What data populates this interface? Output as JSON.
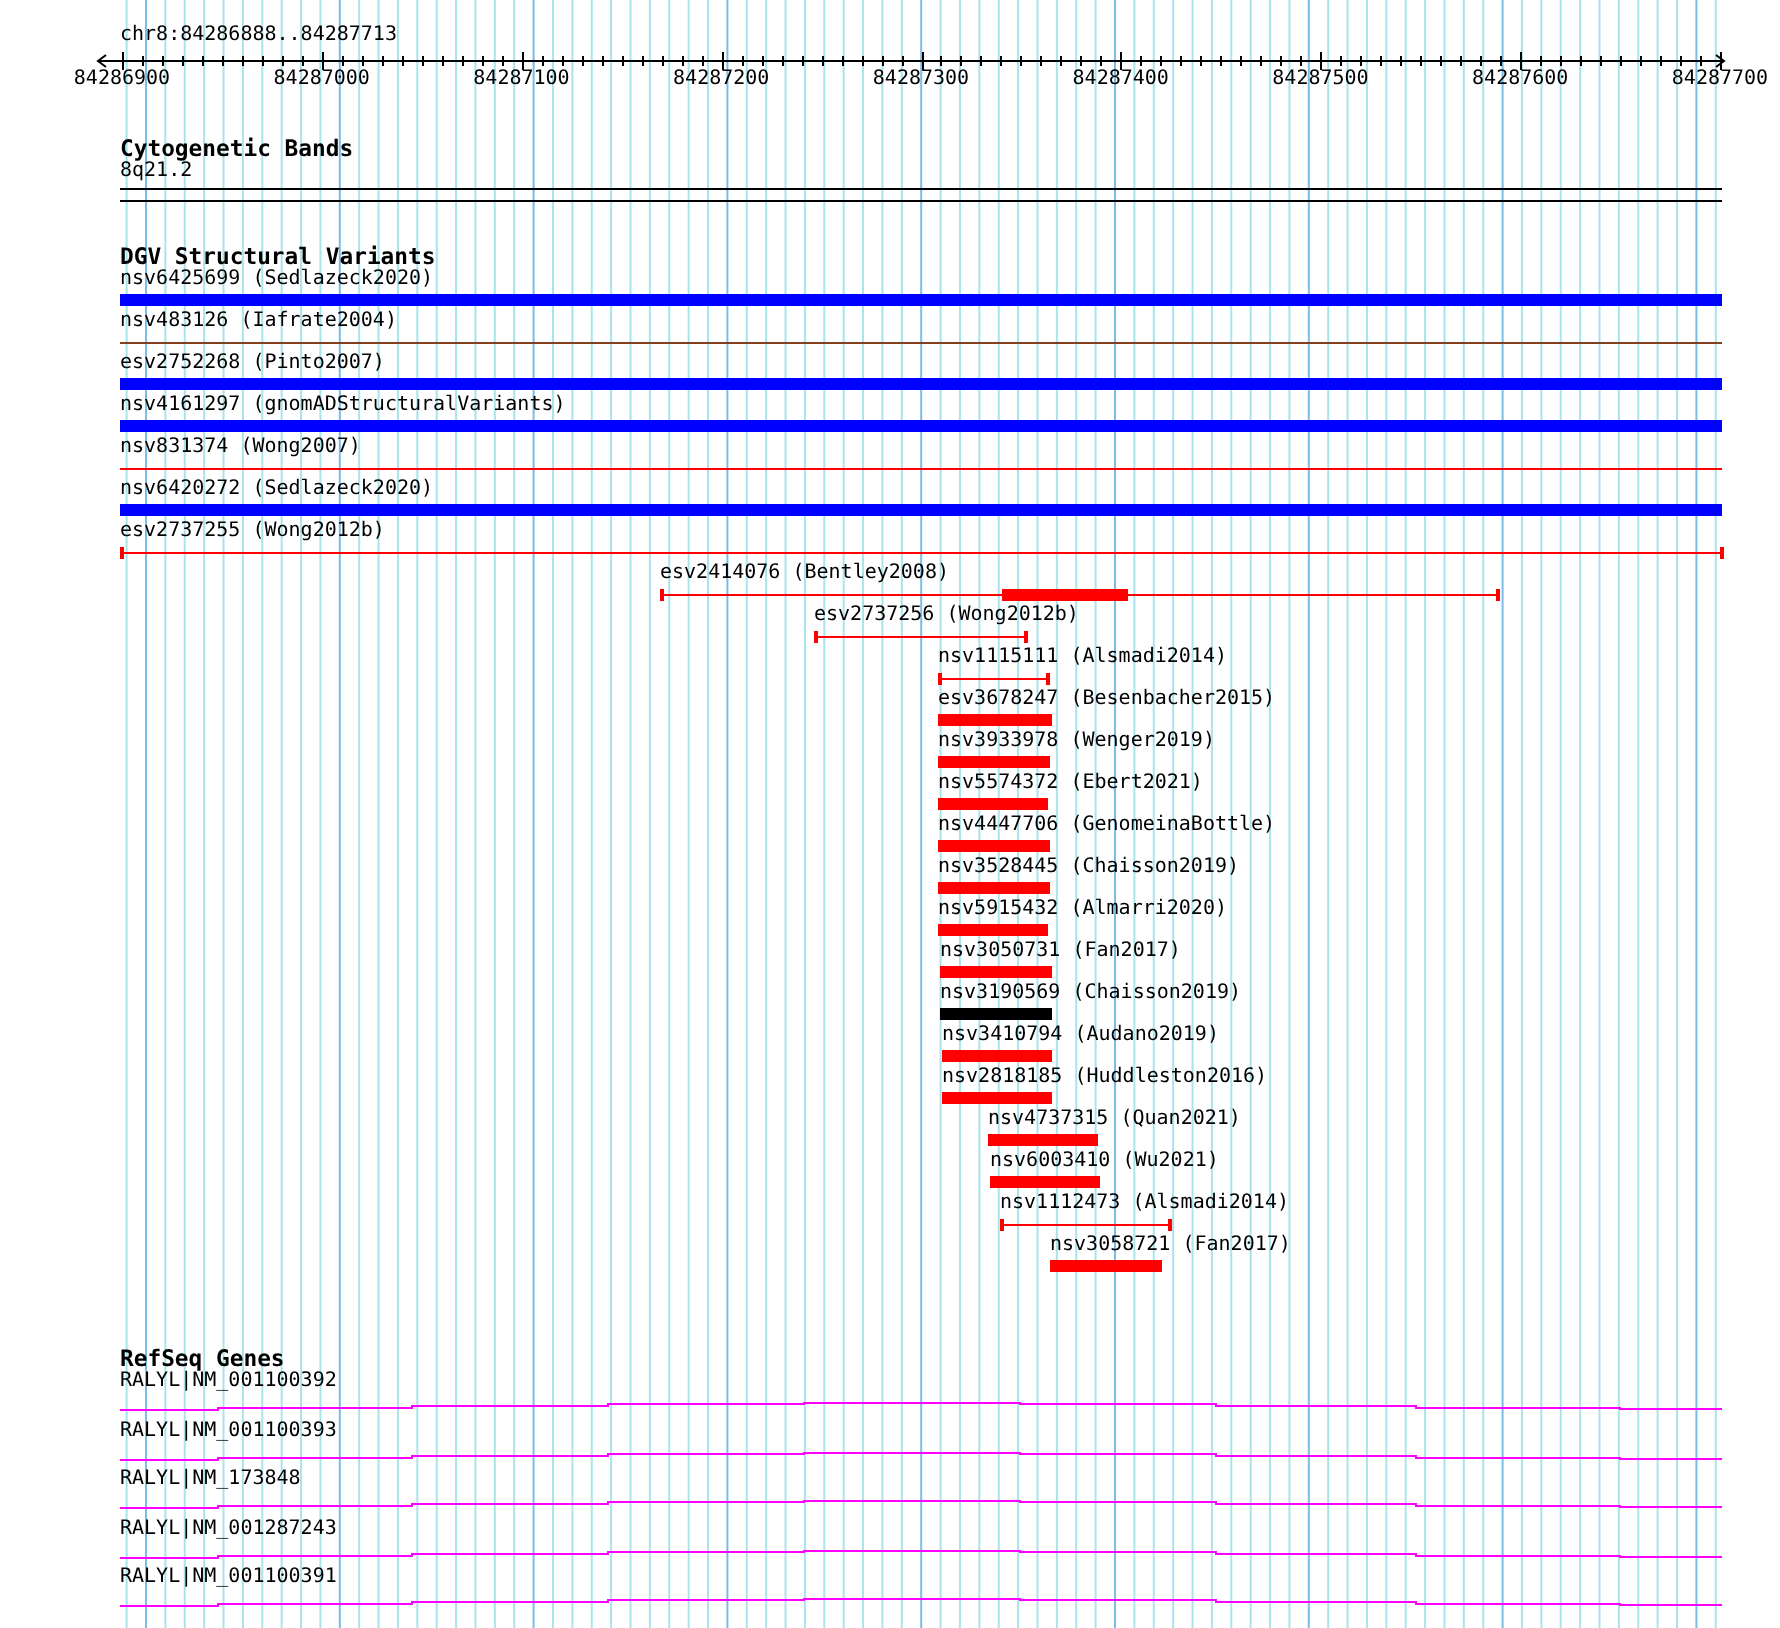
{
  "ruler": {
    "region": "chr8:84286888..84287713",
    "ticks": [
      "84286900",
      "84287000",
      "84287100",
      "84287200",
      "84287300",
      "84287400",
      "84287500",
      "84287600",
      "84287700"
    ]
  },
  "cytogenetic_bands": {
    "title": "Cytogenetic Bands",
    "bands": [
      {
        "label": "8q21.2"
      }
    ]
  },
  "dgv_structural_variants": {
    "title": "DGV Structural Variants",
    "features": [
      {
        "label": "nsv6425699 (Sedlazeck2020)",
        "kind": "bar",
        "color": "#0000ff"
      },
      {
        "label": "nsv483126 (Iafrate2004)",
        "kind": "line",
        "color": "#804020"
      },
      {
        "label": "esv2752268 (Pinto2007)",
        "kind": "bar",
        "color": "#0000ff"
      },
      {
        "label": "nsv4161297 (gnomADStructuralVariants)",
        "kind": "bar",
        "color": "#0000ff"
      },
      {
        "label": "nsv831374 (Wong2007)",
        "kind": "line",
        "color": "#ff0000"
      },
      {
        "label": "nsv6420272 (Sedlazeck2020)",
        "kind": "bar",
        "color": "#0000ff"
      },
      {
        "label": "esv2737255 (Wong2012b)",
        "kind": "line",
        "color": "#ff0000"
      },
      {
        "label": "esv2414076 (Bentley2008)",
        "kind": "line",
        "color": "#ff0000"
      },
      {
        "label": "esv2737256 (Wong2012b)",
        "kind": "line",
        "color": "#ff0000"
      },
      {
        "label": "nsv1115111 (Alsmadi2014)",
        "kind": "line",
        "color": "#ff0000"
      },
      {
        "label": "esv3678247 (Besenbacher2015)",
        "kind": "bar",
        "color": "#ff0000"
      },
      {
        "label": "nsv3933978 (Wenger2019)",
        "kind": "bar",
        "color": "#ff0000"
      },
      {
        "label": "nsv5574372 (Ebert2021)",
        "kind": "bar",
        "color": "#ff0000"
      },
      {
        "label": "nsv4447706 (GenomeinaBottle)",
        "kind": "bar",
        "color": "#ff0000"
      },
      {
        "label": "nsv3528445 (Chaisson2019)",
        "kind": "bar",
        "color": "#ff0000"
      },
      {
        "label": "nsv5915432 (Almarri2020)",
        "kind": "bar",
        "color": "#ff0000"
      },
      {
        "label": "nsv3050731 (Fan2017)",
        "kind": "bar",
        "color": "#ff0000"
      },
      {
        "label": "nsv3190569 (Chaisson2019)",
        "kind": "bar",
        "color": "#000000"
      },
      {
        "label": "nsv3410794 (Audano2019)",
        "kind": "bar",
        "color": "#ff0000"
      },
      {
        "label": "nsv2818185 (Huddleston2016)",
        "kind": "bar",
        "color": "#ff0000"
      },
      {
        "label": "nsv4737315 (Quan2021)",
        "kind": "bar",
        "color": "#ff0000"
      },
      {
        "label": "nsv6003410 (Wu2021)",
        "kind": "bar",
        "color": "#ff0000"
      },
      {
        "label": "nsv1112473 (Alsmadi2014)",
        "kind": "line",
        "color": "#ff0000"
      },
      {
        "label": "nsv3058721 (Fan2017)",
        "kind": "bar",
        "color": "#ff0000"
      }
    ]
  },
  "refseq_genes": {
    "title": "RefSeq Genes",
    "transcripts": [
      {
        "label": "RALYL|NM_001100392"
      },
      {
        "label": "RALYL|NM_001100393"
      },
      {
        "label": "RALYL|NM_173848"
      },
      {
        "label": "RALYL|NM_001287243"
      },
      {
        "label": "RALYL|NM_001100391"
      }
    ]
  }
}
